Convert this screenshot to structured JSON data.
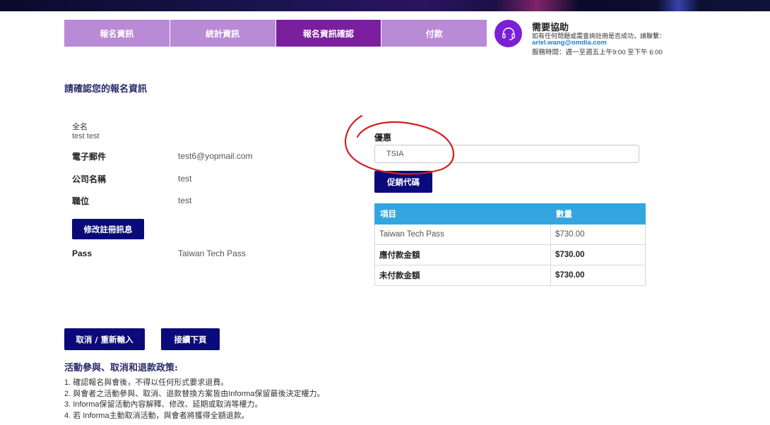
{
  "steps": [
    {
      "label": "報名資訊",
      "active": false
    },
    {
      "label": "統計資訊",
      "active": false
    },
    {
      "label": "報名資訊確認",
      "active": true
    },
    {
      "label": "付款",
      "active": false
    }
  ],
  "help": {
    "title": "需要協助",
    "line1": "如有任何問題或需查詢註冊是否成功，請聯繫：",
    "email": "ariel.wang@omdia.com",
    "hours": "服務時間：週一至週五上午9:00 至下午 6:00",
    "icon": "headset-icon"
  },
  "confirm": {
    "title": "請確認您的報名資訊",
    "fullname_label": "全名",
    "fullname_value": "test test",
    "email_label": "電子郵件",
    "email_value": "test6@yopmail.com",
    "company_label": "公司名稱",
    "company_value": "test",
    "position_label": "職位",
    "position_value": "test",
    "edit_button": "修改註冊訊息",
    "pass_label": "Pass",
    "pass_value": "Taiwan Tech Pass"
  },
  "promo": {
    "label": "優惠",
    "value": "TSIA",
    "button": "促銷代碼"
  },
  "summary": {
    "headers": [
      "項目",
      "數量"
    ],
    "rows": [
      {
        "item": "Taiwan Tech Pass",
        "amount": "$730.00",
        "bold": false
      },
      {
        "item": "應付款金額",
        "amount": "$730.00",
        "bold": true
      },
      {
        "item": "未付款金額",
        "amount": "$730.00",
        "bold": true
      }
    ]
  },
  "actions": {
    "cancel": "取消 / 重新輸入",
    "next": "接續下頁"
  },
  "policy": {
    "title": "活動參與、取消和退款政策:",
    "items": [
      "1. 確認報名與會後，不得以任何形式要求退費。",
      "2. 與會者之活動參與、取消、退款替換方案皆由Informa保留最後決定權力。",
      "3. Informa保留活動內容解釋、修改、延期或取消等權力。",
      "4. 若 Informa主動取消活動，與會者將獲得全額退款。"
    ]
  },
  "colors": {
    "step_inactive": "#b98ad6",
    "step_active": "#7b1f9e",
    "button": "#0b0a7a",
    "table_header": "#33a6e0",
    "annotation": "#d42020"
  }
}
